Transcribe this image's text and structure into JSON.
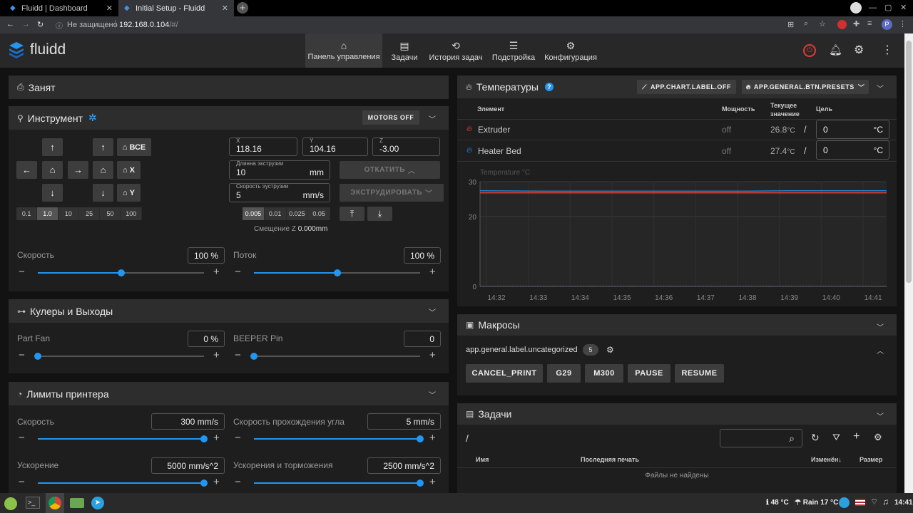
{
  "browser": {
    "tabs": [
      {
        "title": "Fluidd | Dashboard"
      },
      {
        "title": "Initial Setup - Fluidd"
      }
    ],
    "security": "Не защищено",
    "address_host": "192.168.0.104",
    "address_path": "/#/",
    "profile_initial": "P"
  },
  "app": {
    "brand": "fluidd",
    "nav": [
      {
        "label": "Панель управления",
        "icon": "home-icon"
      },
      {
        "label": "Задачи",
        "icon": "file-icon"
      },
      {
        "label": "История задач",
        "icon": "history-icon"
      },
      {
        "label": "Подстройка",
        "icon": "tune-icon"
      },
      {
        "label": "Конфигурация",
        "icon": "cogs-icon"
      }
    ]
  },
  "status": {
    "title": "Занят"
  },
  "tool": {
    "title": "Инструмент",
    "motors_off": "MOTORS OFF",
    "home_all": "ВСЕ",
    "home_x": "X",
    "home_y": "Y",
    "xy_steps": [
      "0.1",
      "1.0",
      "10",
      "25",
      "50",
      "100"
    ],
    "xy_selected": "1.0",
    "x_label": "X",
    "x_value": "118.16",
    "y_label": "Y",
    "y_value": "104.16",
    "z_label": "Z",
    "z_value": "-3.00",
    "extrude_len_label": "Длинна экструзии",
    "extrude_len_value": "10",
    "extrude_len_unit": "mm",
    "extrude_speed_label": "Скорость эуструзии",
    "extrude_speed_value": "5",
    "extrude_speed_unit": "mm/s",
    "retract": "ОТКАТИТЬ",
    "extrude": "ЭКСТРУДИРОВАТЬ",
    "z_steps": [
      "0.005",
      "0.01",
      "0.025",
      "0.05"
    ],
    "z_selected": "0.005",
    "z_offset_label": "Смещение Z",
    "z_offset_value": "0.000mm",
    "speed_label": "Скорость",
    "speed_value": "100 %",
    "speed_fraction": 0.5,
    "flow_label": "Поток",
    "flow_value": "100 %",
    "flow_fraction": 0.5
  },
  "fans": {
    "title": "Кулеры и Выходы",
    "part_fan_label": "Part Fan",
    "part_fan_value": "0 %",
    "part_fan_fraction": 0,
    "beeper_label": "BEEPER Pin",
    "beeper_value": "0",
    "beeper_fraction": 0
  },
  "limits": {
    "title": "Лимиты принтера",
    "velocity_label": "Скорость",
    "velocity_value": "300 mm/s",
    "velocity_fraction": 1,
    "scv_label": "Скорость прохождения угла",
    "scv_value": "5 mm/s",
    "scv_fraction": 1,
    "accel_label": "Ускорение",
    "accel_value": "5000 mm/s^2",
    "accel_fraction": 1,
    "decel_label": "Ускорения и торможения",
    "decel_value": "2500 mm/s^2",
    "decel_fraction": 1
  },
  "temps": {
    "title": "Температуры",
    "chart_btn": "APP.CHART.LABEL.OFF",
    "presets_btn": "APP.GENERAL.BTN.PRESETS",
    "col_element": "Элемент",
    "col_power": "Мощность",
    "col_current_1": "Текущее",
    "col_current_2": "значение",
    "col_target": "Цель",
    "rows": [
      {
        "name": "Extruder",
        "power": "off",
        "current": "26.8",
        "unit": "°C",
        "target": "0",
        "target_unit": "°C",
        "color": "#f44336"
      },
      {
        "name": "Heater Bed",
        "power": "off",
        "current": "27.4",
        "unit": "°C",
        "target": "0",
        "target_unit": "°C",
        "color": "#2196f3"
      }
    ]
  },
  "chart_data": {
    "type": "line",
    "ylabel": "Temperature °C",
    "ylim": [
      0,
      30
    ],
    "yticks": [
      "30",
      "20",
      "0"
    ],
    "categories": [
      "14:32",
      "14:33",
      "14:34",
      "14:35",
      "14:36",
      "14:37",
      "14:38",
      "14:39",
      "14:40",
      "14:41"
    ],
    "series": [
      {
        "name": "Extruder",
        "color": "#f44336",
        "values": [
          26.8,
          26.8,
          26.8,
          26.8,
          26.8,
          26.8,
          26.8,
          26.8,
          26.8,
          26.8
        ]
      },
      {
        "name": "Heater Bed",
        "color": "#2196f3",
        "values": [
          27.4,
          27.3,
          27.3,
          27.3,
          27.3,
          27.3,
          27.3,
          27.4,
          27.4,
          27.4
        ]
      }
    ],
    "grid": true
  },
  "macros": {
    "title": "Макросы",
    "category": "app.general.label.uncategorized",
    "count": "5",
    "buttons": [
      "CANCEL_PRINT",
      "G29",
      "M300",
      "PAUSE",
      "RESUME"
    ]
  },
  "jobs": {
    "title": "Задачи",
    "path": "/",
    "col_name": "Имя",
    "col_last": "Последняя печать",
    "col_modified": "Изменён",
    "col_size": "Размер",
    "empty": "Файлы не найдены"
  },
  "taskbar": {
    "cpu_temp": "48 °C",
    "weather": "Rain 17 °C",
    "time": "14:41"
  }
}
